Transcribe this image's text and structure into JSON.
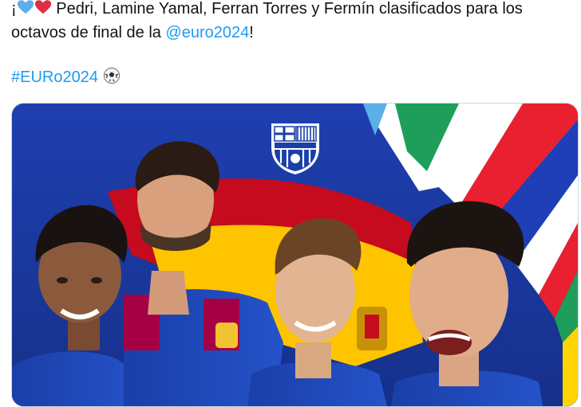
{
  "tweet": {
    "line1_prefix": "¡",
    "line1_text": " Pedri, Lamine Yamal, Ferran Torres y Fermín clasificados para los",
    "line2_text": "octavos de final de la ",
    "mention": "@euro2024",
    "line2_suffix": "!",
    "hashtag": "#EURo2024",
    "emojis": [
      "blue-heart-icon",
      "red-heart-icon",
      "soccer-ball-icon"
    ]
  },
  "media": {
    "description_icons": [
      "fc-barcelona-crest",
      "spain-flag"
    ],
    "colors": {
      "background_blue": "#1c3a9c",
      "jersey_blue": "#1a3fa8",
      "jersey_red": "#a50044",
      "flag_red": "#c60b1e",
      "flag_yellow": "#ffc400",
      "stripe_green": "#1e9e5a",
      "stripe_white": "#ffffff"
    }
  }
}
